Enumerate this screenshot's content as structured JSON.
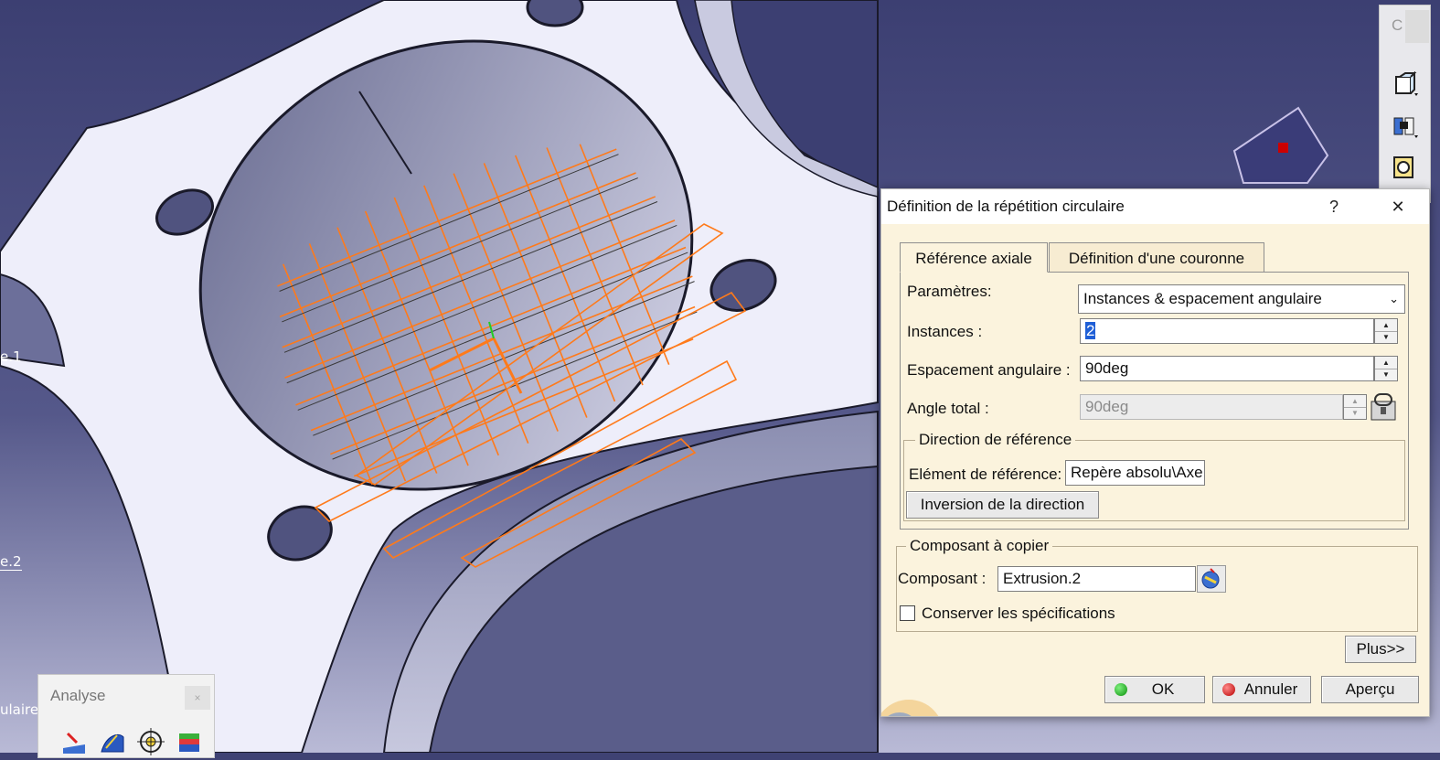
{
  "viewport": {
    "labels": [
      "e.1",
      "e.2",
      "ulaire."
    ],
    "background_color": "#3f4273",
    "part_color": "#eeeefa",
    "wireframe_color": "#ff7a1a"
  },
  "toolbar_right": {
    "title_glyph": "C",
    "icons": [
      "part-body-icon",
      "assembly-icon",
      "hole-icon"
    ]
  },
  "analyse_toolbar": {
    "title": "Analyse",
    "close": "×",
    "icons": [
      "draft-analysis-icon",
      "curvature-analysis-icon",
      "measure-icon",
      "thickness-analysis-icon"
    ]
  },
  "dialog": {
    "title": "Définition de la répétition circulaire",
    "help": "?",
    "close": "✕",
    "tabs": [
      "Référence axiale",
      "Définition d'une couronne"
    ],
    "active_tab": 0,
    "parametres_label": "Paramètres:",
    "parametres_value": "Instances & espacement angulaire",
    "instances_label": "Instances :",
    "instances_value": "2",
    "espacement_label": "Espacement angulaire :",
    "espacement_value": "90deg",
    "angle_total_label": "Angle total :",
    "angle_total_value": "90deg",
    "direction_legend": "Direction de référence",
    "element_label": "Elément de référence:",
    "element_value": "Repère absolu\\Axe",
    "inversion_button": "Inversion de la direction",
    "composant_legend": "Composant à copier",
    "composant_label": "Composant :",
    "composant_value": "Extrusion.2",
    "conserver_label": "Conserver les spécifications",
    "conserver_checked": false,
    "plus_button": "Plus>>",
    "ok_button": "OK",
    "annuler_button": "Annuler",
    "apercu_button": "Aperçu"
  }
}
